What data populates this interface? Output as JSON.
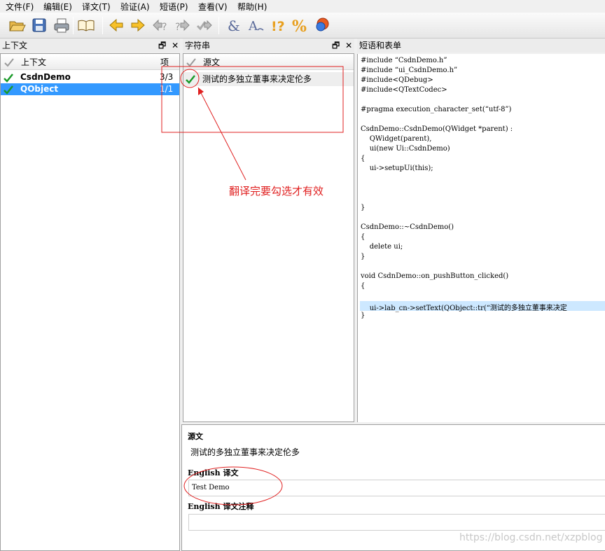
{
  "menu": [
    "文件(F)",
    "编辑(E)",
    "译文(T)",
    "验证(A)",
    "短语(P)",
    "查看(V)",
    "帮助(H)"
  ],
  "toolbar_icons": [
    "open-icon",
    "save-icon",
    "print-icon",
    "phrasebook-icon",
    "prev-icon",
    "next-icon",
    "prev-unfinished-icon",
    "next-unfinished-icon",
    "done-next-icon",
    "accelerator-check-icon",
    "punctuation-check-icon",
    "phrase-check-icon",
    "placemarker-check-icon",
    "whats-this-icon"
  ],
  "context_panel": {
    "title": "上下文",
    "col_context": "上下文",
    "col_items": "项",
    "rows": [
      {
        "name": "CsdnDemo",
        "count": "3/3",
        "selected": false
      },
      {
        "name": "QObject",
        "count": "1/1",
        "selected": true
      }
    ]
  },
  "strings_panel": {
    "title": "字符串",
    "col_source": "源文",
    "rows": [
      {
        "text": "测试的多独立董事来决定伦多",
        "finished": true
      }
    ]
  },
  "code_panel": {
    "title": "短语和表单",
    "lines": [
      "#include “CsdnDemo.h”",
      "#include “ui_CsdnDemo.h”",
      "#include<QDebug>",
      "#include<QTextCodec>",
      "",
      "#pragma execution_character_set(“utf-8”)",
      "",
      "CsdnDemo::CsdnDemo(QWidget *parent) :",
      "    QWidget(parent),",
      "    ui(new Ui::CsdnDemo)",
      "{",
      "    ui->setupUi(this);",
      "",
      "",
      "",
      "}",
      "",
      "CsdnDemo::~CsdnDemo()",
      "{",
      "    delete ui;",
      "}",
      "",
      "void CsdnDemo::on_pushButton_clicked()",
      "{",
      "",
      "    ui->lab_cn->setText(QObject::tr(“测试的多独立董事来决定",
      "}"
    ]
  },
  "editor": {
    "source_label": "源文",
    "source_text": "测试的多独立董事来决定伦多",
    "translation_label": "English 译文",
    "translation_value": "Test Demo",
    "comment_label": "English 译文注释",
    "comment_value": ""
  },
  "annotation": {
    "text": "翻译完要勾选才有效",
    "color": "#e02020"
  },
  "watermark": "https://blog.csdn.net/xzpblog",
  "colors": {
    "selection": "#3399ff",
    "check_green": "#1a9a2a",
    "highlight_line": "#cde8ff"
  }
}
